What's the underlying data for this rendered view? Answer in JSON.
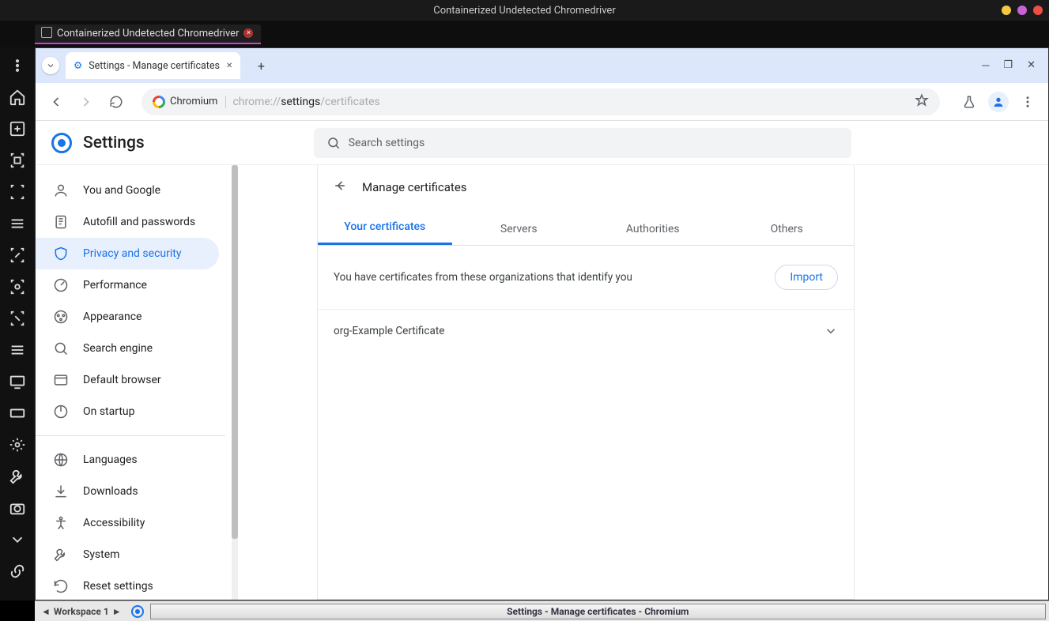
{
  "os": {
    "title": "Containerized Undetected Chromedriver",
    "app_tab": "Containerized Undetected Chromedriver",
    "workspace": "Workspace 1",
    "task_label": "Settings - Manage certificates - Chromium"
  },
  "browser": {
    "tab_title": "Settings - Manage certificates",
    "omnibox_chip": "Chromium",
    "url_prefix": "chrome://",
    "url_bold": "settings",
    "url_suffix": "/certificates"
  },
  "settings": {
    "title": "Settings",
    "search_placeholder": "Search settings",
    "sidebar": {
      "items": [
        "You and Google",
        "Autofill and passwords",
        "Privacy and security",
        "Performance",
        "Appearance",
        "Search engine",
        "Default browser",
        "On startup",
        "Languages",
        "Downloads",
        "Accessibility",
        "System",
        "Reset settings"
      ]
    }
  },
  "panel": {
    "title": "Manage certificates",
    "tabs": [
      "Your certificates",
      "Servers",
      "Authorities",
      "Others"
    ],
    "description": "You have certificates from these organizations that identify you",
    "import_label": "Import",
    "cert_org": "org-Example Certificate"
  }
}
